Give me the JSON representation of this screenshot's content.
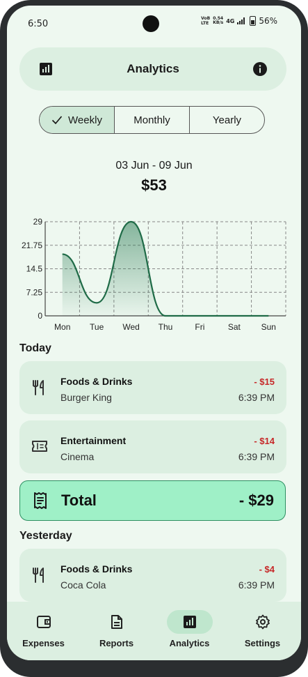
{
  "status_bar": {
    "time": "6:50",
    "volte_top": "VoB",
    "volte_bottom": "LTE",
    "speed_value": "0.54",
    "speed_unit": "KB/s",
    "network": "4G",
    "battery_percent": "56%",
    "battery_level": 0.56
  },
  "header": {
    "title": "Analytics",
    "left_icon": "analytics-icon",
    "right_icon": "info-icon"
  },
  "period_tabs": [
    {
      "label": "Weekly",
      "selected": true
    },
    {
      "label": "Monthly",
      "selected": false
    },
    {
      "label": "Yearly",
      "selected": false
    }
  ],
  "summary": {
    "date_range": "03 Jun - 09 Jun",
    "total": "$53"
  },
  "chart_data": {
    "type": "area",
    "categories": [
      "Mon",
      "Tue",
      "Wed",
      "Thu",
      "Fri",
      "Sat",
      "Sun"
    ],
    "values": [
      19,
      4,
      29,
      0,
      0,
      0,
      0
    ],
    "y_ticks": [
      "29",
      "21.75",
      "14.5",
      "7.25",
      "0"
    ],
    "ylim": [
      0,
      29
    ],
    "grid": true,
    "line_color": "#1f6b47",
    "fill_color": "#2e7d57"
  },
  "sections": [
    {
      "title": "Today",
      "items": [
        {
          "icon": "fork-knife-icon",
          "category": "Foods & Drinks",
          "merchant": "Burger King",
          "amount": "- $15",
          "time": "6:39 PM"
        },
        {
          "icon": "ticket-icon",
          "category": "Entertainment",
          "merchant": "Cinema",
          "amount": "- $14",
          "time": "6:39 PM"
        }
      ],
      "total_label": "Total",
      "total_value": "- $29"
    },
    {
      "title": "Yesterday",
      "items": [
        {
          "icon": "fork-knife-icon",
          "category": "Foods & Drinks",
          "merchant": "Coca Cola",
          "amount": "- $4",
          "time": "6:39 PM"
        }
      ]
    }
  ],
  "bottom_nav": [
    {
      "label": "Expenses",
      "icon": "wallet-icon",
      "active": false
    },
    {
      "label": "Reports",
      "icon": "document-icon",
      "active": false
    },
    {
      "label": "Analytics",
      "icon": "analytics-icon",
      "active": true
    },
    {
      "label": "Settings",
      "icon": "gear-icon",
      "active": false
    }
  ],
  "colors": {
    "background": "#eef8f0",
    "card": "#dcefe1",
    "accent": "#9ff0c7",
    "negative": "#c62828"
  }
}
